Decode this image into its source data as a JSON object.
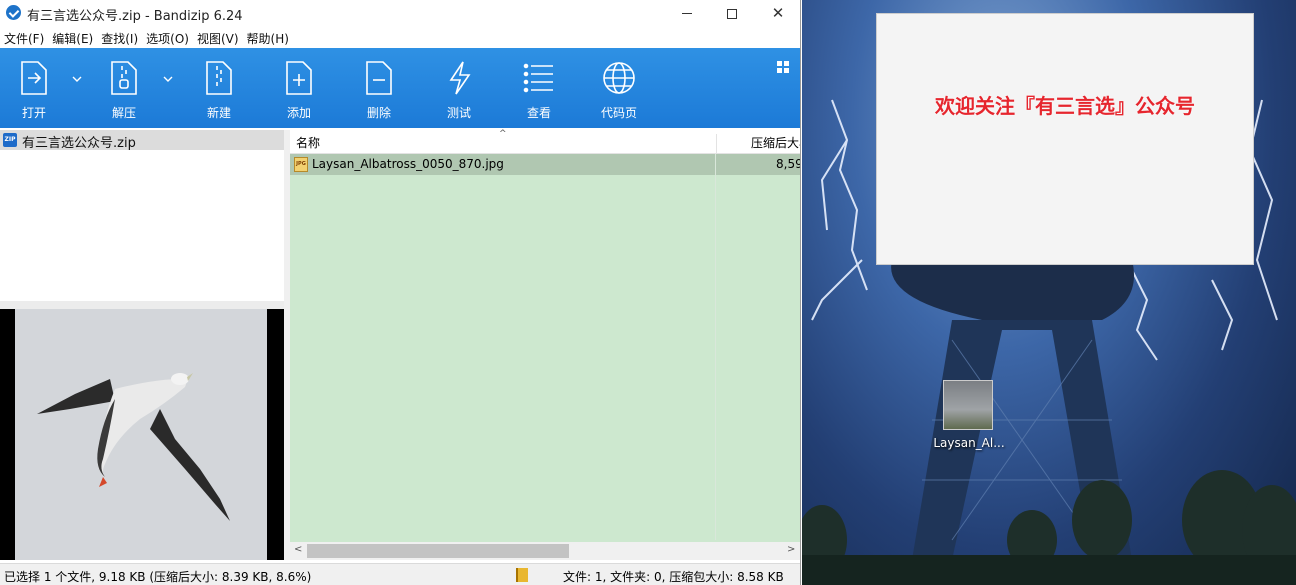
{
  "window": {
    "title": "有三言选公众号.zip - Bandizip 6.24",
    "min_label": "",
    "max_label": "",
    "close_label": "✕"
  },
  "menu": [
    "文件(F)",
    "编辑(E)",
    "查找(I)",
    "选项(O)",
    "视图(V)",
    "帮助(H)"
  ],
  "toolbar": {
    "open": "打开",
    "extract": "解压",
    "new": "新建",
    "add": "添加",
    "delete": "删除",
    "test": "测试",
    "view": "查看",
    "codepage": "代码页"
  },
  "tree": {
    "archive_name": "有三言选公众号.zip",
    "zip_badge": "ZIP"
  },
  "filelist": {
    "col_name": "名称",
    "col_packed_size": "压缩后大小",
    "files": [
      {
        "name": "Laysan_Albatross_0050_870.jpg",
        "packed_size": "8,59",
        "type_badge": "JPG"
      }
    ]
  },
  "status": {
    "selection": "已选择 1 个文件, 9.18 KB (压缩后大小: 8.39 KB, 8.6%)",
    "summary": "文件: 1, 文件夹: 0, 压缩包大小: 8.58 KB"
  },
  "desktop": {
    "notice_text": "欢迎关注『有三言选』公众号",
    "icon_label": "Laysan_Al..."
  },
  "colors": {
    "toolbar": "#1c7ad7",
    "list_bg": "#cde8cf",
    "selected_row": "#b0c7b1",
    "notice_text": "#e6262e"
  }
}
